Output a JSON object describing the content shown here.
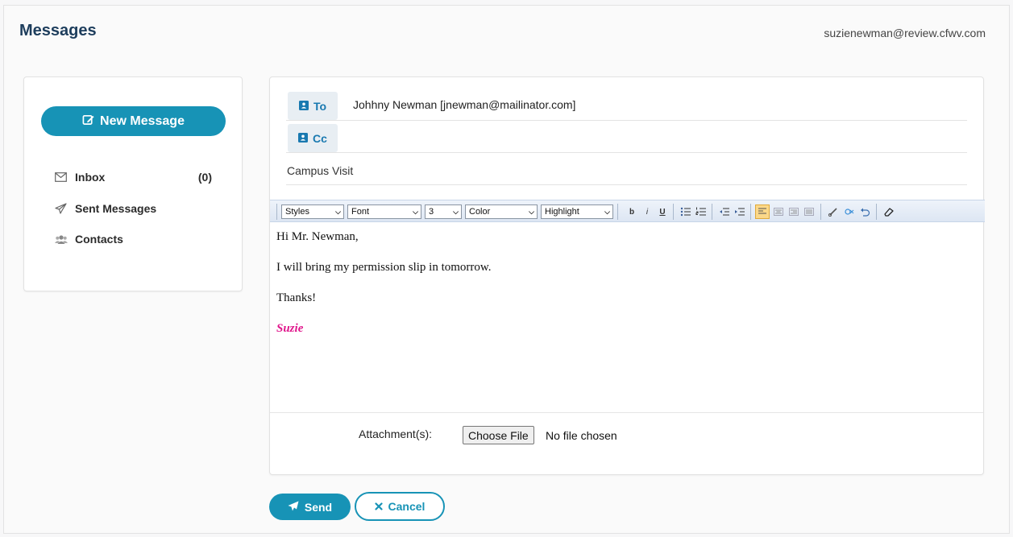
{
  "header": {
    "title": "Messages",
    "user_email": "suzienewman@review.cfwv.com"
  },
  "sidebar": {
    "new_message_label": "New Message",
    "items": [
      {
        "label": "Inbox",
        "icon": "envelope-icon",
        "count": "(0)"
      },
      {
        "label": "Sent Messages",
        "icon": "paper-plane-icon"
      },
      {
        "label": "Contacts",
        "icon": "users-icon"
      }
    ]
  },
  "compose": {
    "to_label": "To",
    "to_value": "Johhny Newman [jnewman@mailinator.com]",
    "cc_label": "Cc",
    "cc_value": "",
    "subject": "Campus Visit",
    "toolbar": {
      "styles": "Styles",
      "font": "Font",
      "size": "3",
      "color": "Color",
      "highlight": "Highlight"
    },
    "body": {
      "line1": "Hi Mr. Newman,",
      "line2": "I will bring my permission slip in tomorrow.",
      "line3": "Thanks!",
      "signature": "Suzie"
    },
    "attachments_label": "Attachment(s):",
    "choose_file_label": "Choose File",
    "no_file_text": "No file chosen"
  },
  "actions": {
    "send_label": "Send",
    "cancel_label": "Cancel"
  },
  "colors": {
    "accent": "#1793b6",
    "title": "#1d3d5c",
    "signature": "#e0178c",
    "address_button_bg": "#e8eef3"
  }
}
